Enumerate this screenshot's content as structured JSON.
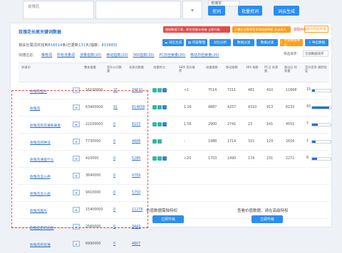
{
  "search": {
    "input1_value": "玫瑰花",
    "input2_value": "",
    "keyword_value": "玫瑰花",
    "btn_search": "挖词",
    "btn_batch": "批量挖词",
    "btn_cloud": "词云生成"
  },
  "panel": {
    "title": "玫瑰花长尾关键词数据",
    "promo_red": "限制数据下载，职位挖掘计划者 立即升级",
    "promo_orange": "只需企业版享受多项权益特权 点击进入",
    "promo_api": "获取API",
    "promo_upgrade": "会员权益升级",
    "summary_prefix": "相关长尾词共找到",
    "summary_total": "816014",
    "summary_mid1": "条(已更新",
    "summary_updated": "131",
    "summary_mid2": "天/指数：",
    "summary_index": "815683",
    "summary_suffix": "]"
  },
  "quickfilter": {
    "label": "快捷过滤：",
    "items": [
      "推荐词",
      "所有流量词",
      "流量指数(20)",
      "移动指数(20)",
      "360指数(20)",
      "PC日检索量(20)",
      "移动日检索量(20)"
    ]
  },
  "toolbar": {
    "cloud": "词云生成",
    "content": "内容整理",
    "batch_compare": "对比分析",
    "batch_filter": "数据过滤",
    "filter": "数据过滤",
    "export_more": "大量数据导出",
    "export": "导出数据",
    "sort_label": "筛选排序：",
    "sort_value": "全部数据排序"
  },
  "table": {
    "headers": [
      "关键词",
      "",
      "整体搜量",
      "竞价公司数量",
      "长尾词数量",
      "流量特点",
      "SEM 竞价推荐",
      "流量指数",
      "移动指数",
      "360 指数",
      "PC日 检索量",
      "移动日 检索量",
      "竞价竞争 激烈程度"
    ],
    "rows": [
      {
        "kw": "玫瑰花图片",
        "total": "16100000",
        "companies": "25",
        "longtail": "74632",
        "sem": "<1",
        "flow": "7514",
        "mobile": "7211",
        "s360": "481",
        "pc": "410",
        "mdaily": "11668",
        "level": 0.15,
        "level_label": "15"
      },
      {
        "kw": "玫瑰花",
        "total": "63400000",
        "companies": "91",
        "longtail": "814658",
        "sem": "1.26",
        "flow": "4887",
        "mobile": "4257",
        "s360": "4310",
        "pc": "913",
        "mdaily": "8133",
        "level": 0.93,
        "level_label": "93"
      },
      {
        "kw": "玫瑰花的花语和寓意",
        "total": "22100000",
        "companies": "0",
        "longtail": "8103",
        "sem": "1.56",
        "flow": "2900",
        "mobile": "2741",
        "s360": "23",
        "pc": "141",
        "mdaily": "4551",
        "level": 0.3,
        "level_label": "7"
      },
      {
        "kw": "玫瑰花的种法",
        "total": "7730000",
        "companies": "0",
        "longtail": "4888",
        "sem": "-",
        "flow": "1988",
        "mobile": "1714",
        "s360": "315",
        "pc": "129",
        "mdaily": "2616",
        "level": 0.2,
        "level_label": "1"
      },
      {
        "kw": "玫瑰花语是什么",
        "total": "410000",
        "companies": "0",
        "longtail": "5286",
        "sem": "<20",
        "flow": "1703",
        "mobile": "1490",
        "s360": "174",
        "pc": "231",
        "mdaily": "2272",
        "level": 0.25,
        "level_label": "8"
      },
      {
        "kw": "玫瑰花怎么养",
        "total": "3640000",
        "companies": "0",
        "longtail": "4769",
        "sem": "",
        "flow": "",
        "mobile": "",
        "s360": "",
        "pc": "",
        "mdaily": "",
        "level": null,
        "level_label": ""
      },
      {
        "kw": "玫瑰花怎么画",
        "total": "9410000",
        "companies": "0",
        "longtail": "5750",
        "sem": "",
        "flow": "",
        "mobile": "",
        "s360": "",
        "pc": "",
        "mdaily": "",
        "level": null,
        "level_label": ""
      },
      {
        "kw": "玫瑰花图片",
        "total": "15400000",
        "companies": "0",
        "longtail": "11278",
        "sem": "",
        "flow": "",
        "mobile": "",
        "s360": "",
        "pc": "",
        "mdaily": "",
        "level": null,
        "level_label": ""
      },
      {
        "kw": "玫瑰花茶的功效",
        "total": "2560000",
        "companies": "0",
        "longtail": "3443",
        "sem": "",
        "flow": "",
        "mobile": "",
        "s360": "",
        "pc": "",
        "mdaily": "",
        "level": null,
        "level_label": ""
      },
      {
        "kw": "玫瑰花的花语",
        "total": "6990000",
        "companies": "0",
        "longtail": "4807",
        "sem": "",
        "flow": "",
        "mobile": "",
        "s360": "",
        "pc": "",
        "mdaily": "",
        "level": null,
        "level_label": ""
      }
    ]
  },
  "lock": {
    "left_text": "价值数据需独特权",
    "left_btn": "立即升级",
    "right_text": "查看价值数据，请在高级特权",
    "right_btn": "立即升级"
  },
  "colors": {
    "accent": "#2b8ef0",
    "red": "#e34a4a",
    "orange": "#ff9f1a",
    "tag_green": "#35b8a0",
    "tag_blue": "#3d7fd6"
  }
}
